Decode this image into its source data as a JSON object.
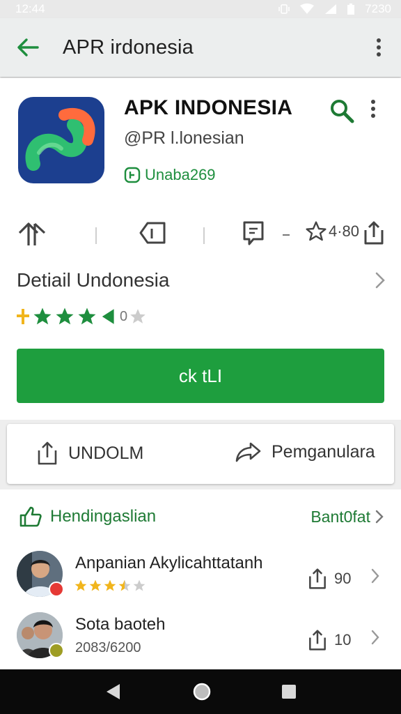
{
  "status_bar": {
    "time": "12:44",
    "battery_text": "7230"
  },
  "app_bar": {
    "title": "APR irdonesia"
  },
  "app": {
    "name": "APK INDONESIA",
    "developer": "@PR l.lonesian",
    "badge": "Unaba269",
    "icon": "swirl-logo-icon"
  },
  "stats": {
    "rating_value": "4·80"
  },
  "detail": {
    "title": "Detiail Undonesia",
    "rating_count": "0"
  },
  "rating": {
    "filled": 4,
    "of": 6
  },
  "install": {
    "label": "ck tLI"
  },
  "actions": {
    "share_label": "UNDOLM",
    "forward_label": "Pemganulara"
  },
  "reviews": {
    "title": "Hendingaslian",
    "more": "Bant0fat",
    "items": [
      {
        "name": "Anpanian Akylicahttatanh",
        "count": "90",
        "stars": 3.5
      },
      {
        "name": "Sota baoteh",
        "sub": "2083/6200",
        "count": "10"
      }
    ]
  },
  "colors": {
    "accent": "#1e9e3e",
    "accent_text": "#1e7a34",
    "icon_bg": "#1c3f8f",
    "star": "#1e8e3e",
    "review_star": "#f1b51c"
  }
}
